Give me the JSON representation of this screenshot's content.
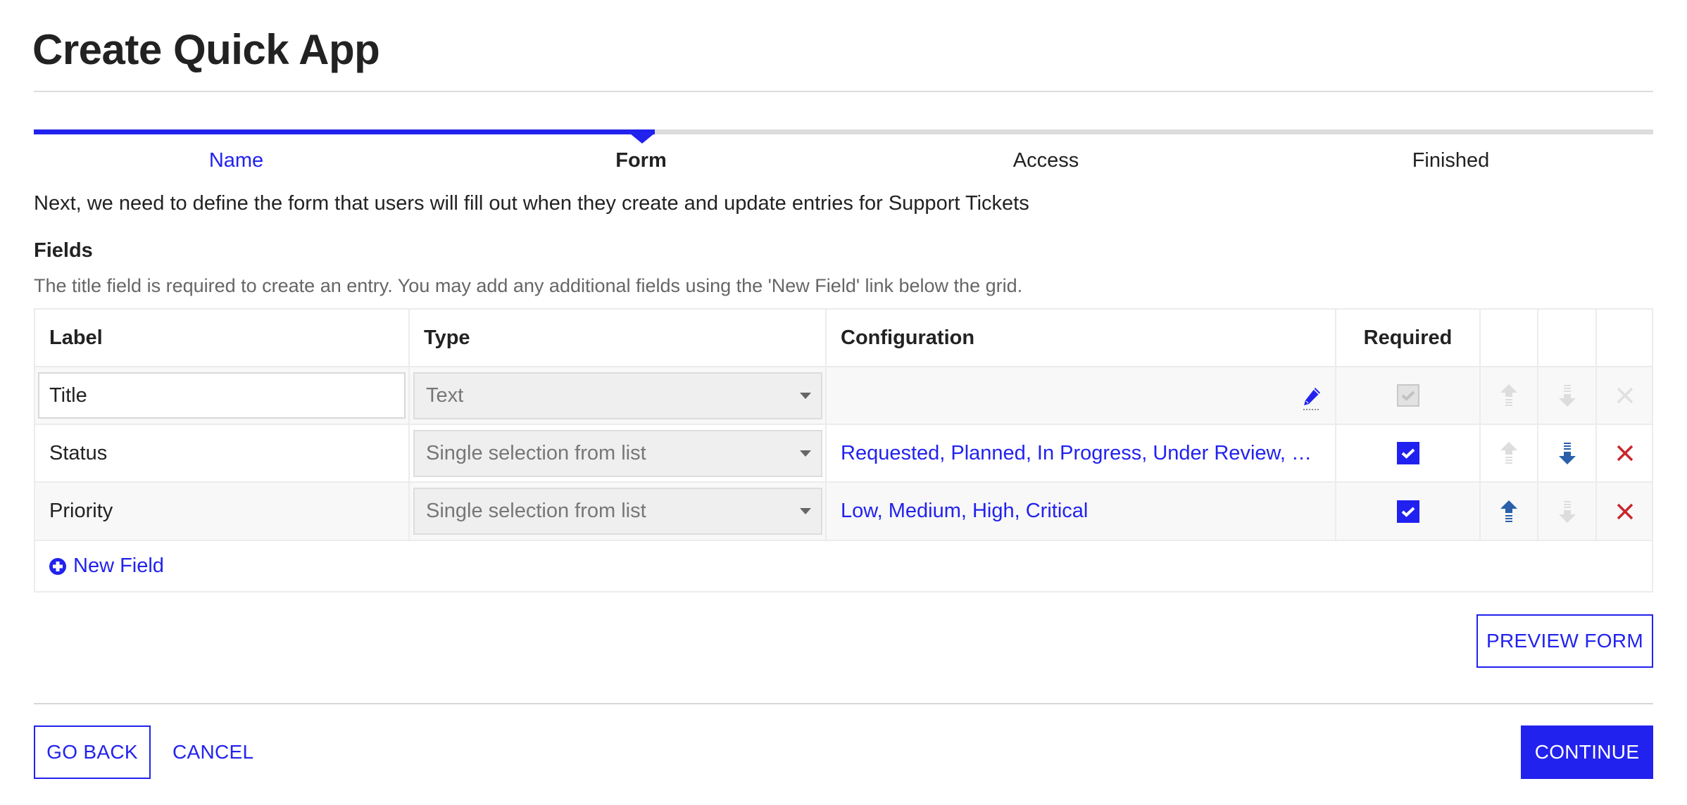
{
  "page": {
    "title": "Create Quick App"
  },
  "stepper": {
    "steps": [
      {
        "label": "Name",
        "state": "done"
      },
      {
        "label": "Form",
        "state": "current"
      },
      {
        "label": "Access",
        "state": "upcoming"
      },
      {
        "label": "Finished",
        "state": "upcoming"
      }
    ],
    "progress_fraction": 0.375,
    "current_step_index": 1
  },
  "intro": {
    "text": "Next, we need to define the form that users will fill out when they create and update entries for Support Tickets"
  },
  "fields_section": {
    "heading": "Fields",
    "hint": "The title field is required to create an entry. You may add any additional fields using the 'New Field' link below the grid."
  },
  "grid": {
    "columns": [
      "Label",
      "Type",
      "Configuration",
      "Required",
      "",
      "",
      ""
    ],
    "rows": [
      {
        "label": "Title",
        "label_editable": true,
        "type": "Text",
        "configuration": "",
        "configuration_icon": "pencil-icon",
        "required": true,
        "required_locked": true,
        "move_up_enabled": false,
        "move_down_enabled": false,
        "delete_enabled": false
      },
      {
        "label": "Status",
        "label_editable": false,
        "type": "Single selection from list",
        "configuration": "Requested, Planned, In Progress, Under Review, C...",
        "required": true,
        "required_locked": false,
        "move_up_enabled": false,
        "move_down_enabled": true,
        "delete_enabled": true
      },
      {
        "label": "Priority",
        "label_editable": false,
        "type": "Single selection from list",
        "configuration": "Low, Medium, High, Critical",
        "required": true,
        "required_locked": false,
        "move_up_enabled": true,
        "move_down_enabled": false,
        "delete_enabled": true
      }
    ],
    "new_field_label": "New Field",
    "new_field_icon": "plus-circle-icon"
  },
  "actions": {
    "preview_form": "PREVIEW FORM",
    "go_back": "GO BACK",
    "cancel": "CANCEL",
    "continue": "CONTINUE"
  },
  "colors": {
    "accent": "#2222ee",
    "move_enabled": "#2a5faa",
    "move_disabled": "#dddddd",
    "delete": "#c8262c",
    "delete_disabled": "#e0e0e0",
    "text": "#222222",
    "muted_text": "#666666"
  }
}
